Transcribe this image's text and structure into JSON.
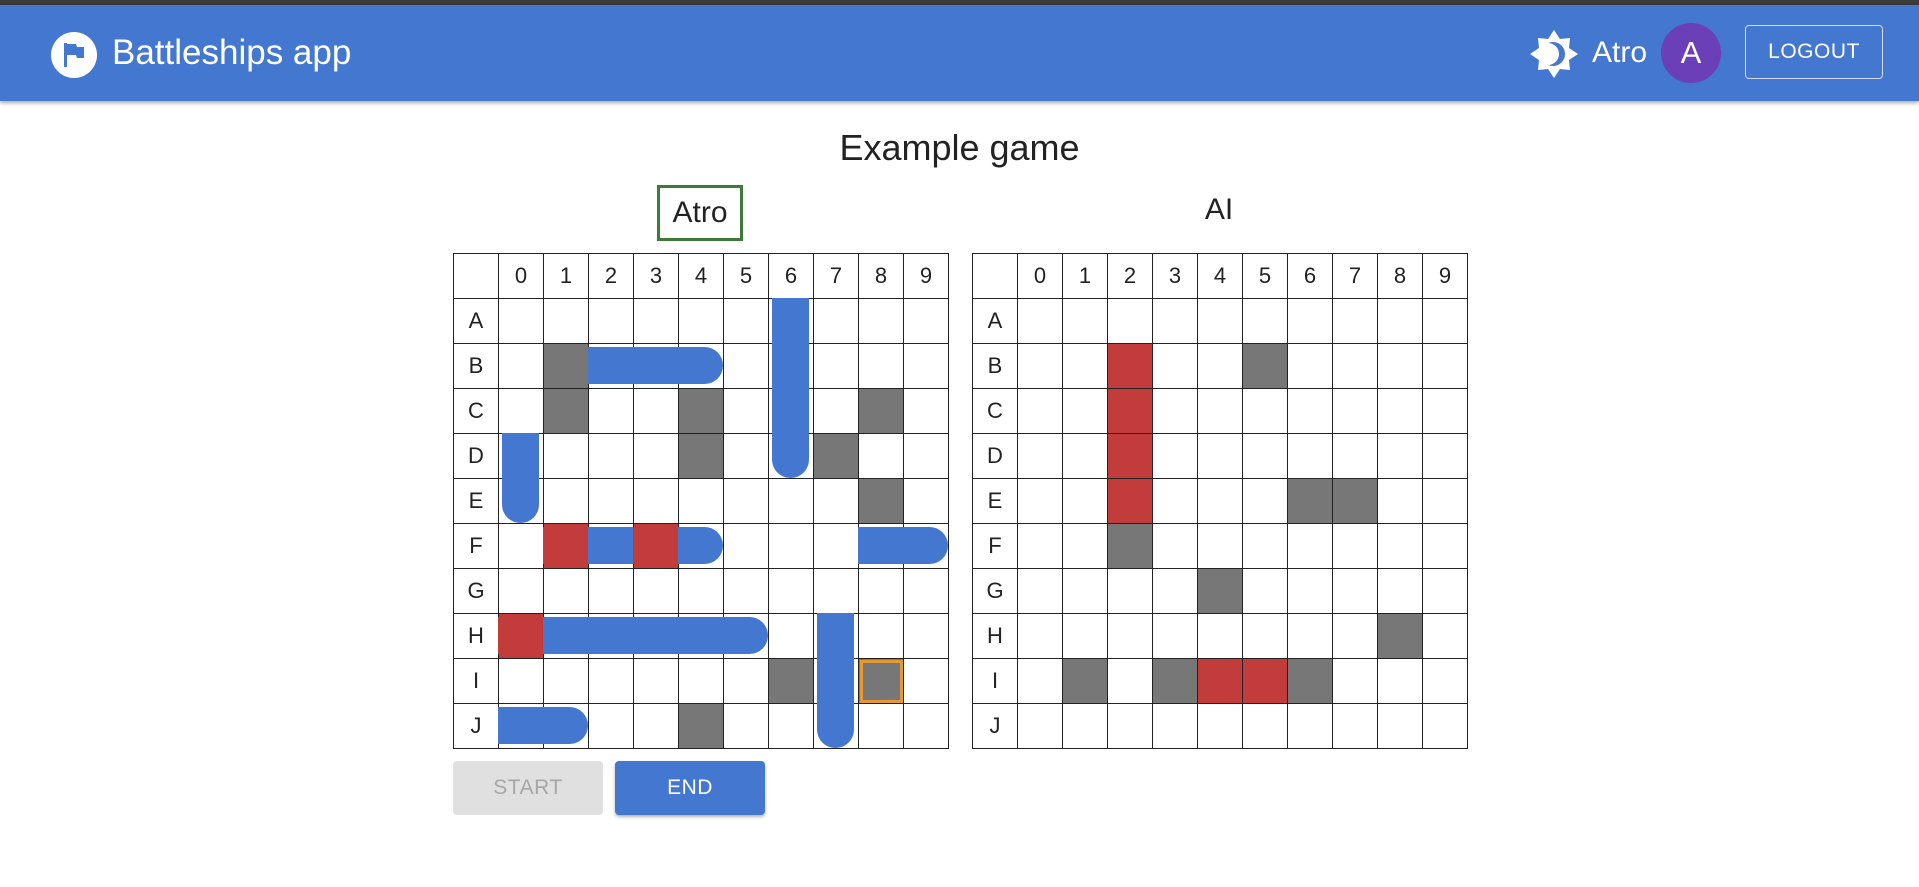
{
  "app": {
    "title": "Battleships app",
    "logo_icon": "flag-icon",
    "theme_icon": "brightness-icon",
    "user_name": "Atro",
    "avatar_initial": "A",
    "logout_label": "LOGOUT"
  },
  "game": {
    "title": "Example game",
    "columns": [
      "0",
      "1",
      "2",
      "3",
      "4",
      "5",
      "6",
      "7",
      "8",
      "9"
    ],
    "rows": [
      "A",
      "B",
      "C",
      "D",
      "E",
      "F",
      "G",
      "H",
      "I",
      "J"
    ],
    "start_label": "START",
    "end_label": "END",
    "players": [
      {
        "name": "Atro",
        "active": true,
        "misses": [
          "B1",
          "C1",
          "C4",
          "D4",
          "D7",
          "C8",
          "E8",
          "I6",
          "I8",
          "J4"
        ],
        "hits": [
          "F1",
          "F3",
          "H0"
        ],
        "selected": "I8",
        "ships": [
          {
            "from": "A6",
            "to": "D6"
          },
          {
            "from": "B2",
            "to": "B4"
          },
          {
            "from": "D0",
            "to": "E0"
          },
          {
            "from": "F1",
            "to": "F4"
          },
          {
            "from": "F8",
            "to": "F9"
          },
          {
            "from": "H0",
            "to": "H5"
          },
          {
            "from": "H7",
            "to": "J7"
          },
          {
            "from": "J0",
            "to": "J1"
          }
        ]
      },
      {
        "name": "AI",
        "active": false,
        "misses": [
          "B5",
          "E6",
          "E7",
          "F2",
          "G4",
          "H8",
          "I1",
          "I3",
          "I6"
        ],
        "hits": [
          "B2",
          "C2",
          "D2",
          "E2",
          "I4",
          "I5"
        ],
        "selected": "",
        "ships": []
      }
    ]
  },
  "colors": {
    "primary": "#4477d0",
    "ship": "#4477d0",
    "hit": "#c13c3b",
    "miss": "#777777",
    "selected": "#e59a36",
    "active_player_border": "#3e7a3a",
    "avatar": "#6a3fb8"
  }
}
